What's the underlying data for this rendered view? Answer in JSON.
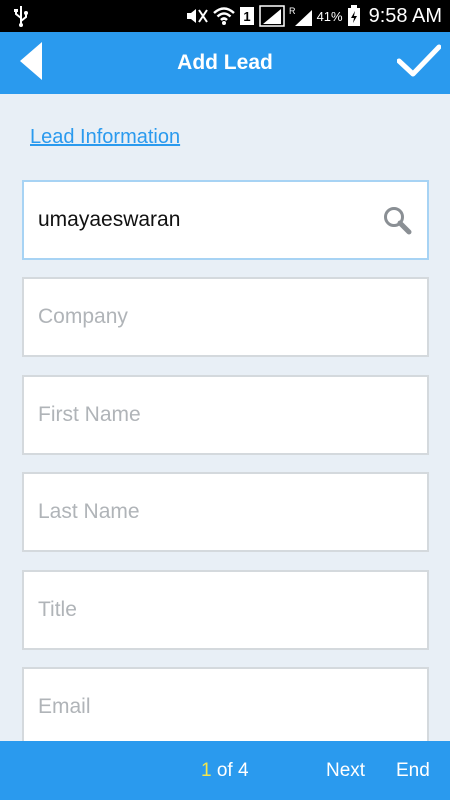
{
  "status_bar": {
    "battery_percent": "41%",
    "time": "9:58 AM",
    "icons": [
      "usb-icon",
      "mute-icon",
      "wifi-icon",
      "sim-1-icon",
      "signal-icon",
      "roaming-signal-icon",
      "battery-charging-icon"
    ]
  },
  "app_bar": {
    "title": "Add Lead",
    "back_icon": "back-arrow-icon",
    "save_icon": "checkmark-icon"
  },
  "form": {
    "section_title": "Lead Information",
    "fields": [
      {
        "name": "owner",
        "value": "umayaeswaran",
        "placeholder": ""
      },
      {
        "name": "company",
        "value": "",
        "placeholder": "Company"
      },
      {
        "name": "first_name",
        "value": "",
        "placeholder": "First Name"
      },
      {
        "name": "last_name",
        "value": "",
        "placeholder": "Last Name"
      },
      {
        "name": "title",
        "value": "",
        "placeholder": "Title"
      },
      {
        "name": "email",
        "value": "",
        "placeholder": "Email"
      }
    ]
  },
  "pager": {
    "current": "1",
    "suffix": " of 4",
    "next_label": "Next",
    "end_label": "End"
  },
  "colors": {
    "accent": "#2a9aee",
    "background": "#e8eff6",
    "current_page": "#f4e64a"
  }
}
